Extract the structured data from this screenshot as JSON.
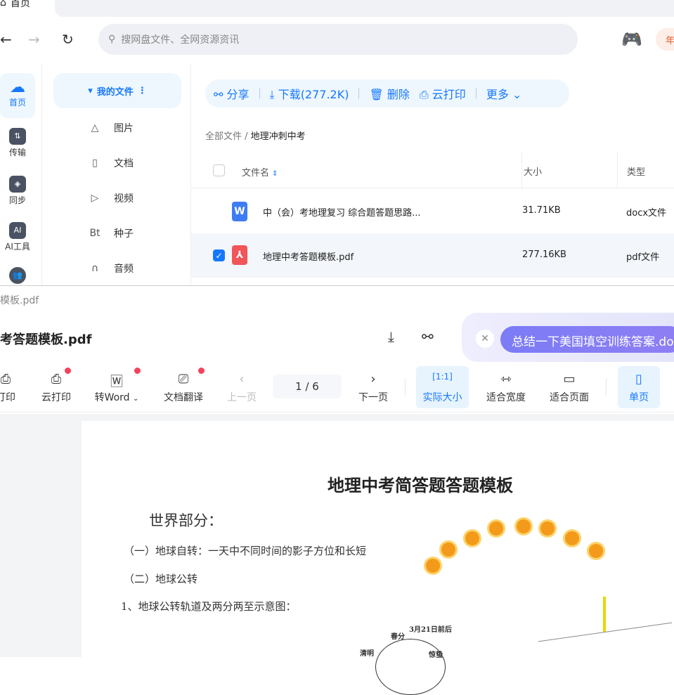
{
  "tab": {
    "label": "首页"
  },
  "nav": {
    "search_placeholder": "搜网盘文件、全网资源资讯",
    "badge": "年"
  },
  "rail": [
    {
      "label": "首页",
      "icon": "cloud-icon"
    },
    {
      "label": "传输",
      "icon": "transfer-icon"
    },
    {
      "label": "同步",
      "icon": "sync-icon"
    },
    {
      "label": "AI工具",
      "icon": "ai-icon"
    }
  ],
  "side": {
    "my_files": "我的文件",
    "items": [
      {
        "label": "图片",
        "icon": "image-icon"
      },
      {
        "label": "文档",
        "icon": "document-icon"
      },
      {
        "label": "视频",
        "icon": "video-icon"
      },
      {
        "label": "种子",
        "icon": "torrent-icon"
      },
      {
        "label": "音频",
        "icon": "audio-icon"
      }
    ]
  },
  "toolbar": {
    "share": "分享",
    "download": "下载(277.2K)",
    "delete": "删除",
    "cloud_print": "云打印",
    "more": "更多"
  },
  "breadcrumb": {
    "root": "全部文件",
    "current": "地理冲刺中考"
  },
  "table": {
    "headers": [
      "文件名",
      "大小",
      "类型"
    ],
    "rows": [
      {
        "name": "中（会）考地理复习 综合题答题思路...",
        "size": "31.71KB",
        "type": "docx文件",
        "selected": false
      },
      {
        "name": "地理中考答题模板.pdf",
        "size": "277.16KB",
        "type": "pdf文件",
        "selected": true
      }
    ]
  },
  "preview": {
    "window_title": "模板.pdf",
    "file_name": "考答题模板.pdf",
    "ai_suggestion": "总结一下美国填空训练答案.docx",
    "tools": {
      "print": "打印",
      "cloud_print": "云打印",
      "to_word": "转Word",
      "translate": "文档翻译",
      "prev": "上一页",
      "page": "1  / 6",
      "next": "下一页",
      "actual": "实际大小",
      "fit_width": "适合宽度",
      "fit_page": "适合页面",
      "single": "单页"
    }
  },
  "doc": {
    "title": "地理中考简答题答题模板",
    "section": "世界部分：",
    "line1": "（一）地球自转：一天中不同时间的影子方位和长短",
    "line2": "（二）地球公转",
    "line3": "1、地球公转轨道及两分两至示意图：",
    "fig_label1": "3月21日前后",
    "fig_label2": "春分",
    "fig_label3": "清明",
    "fig_label4": "惊蛰"
  }
}
